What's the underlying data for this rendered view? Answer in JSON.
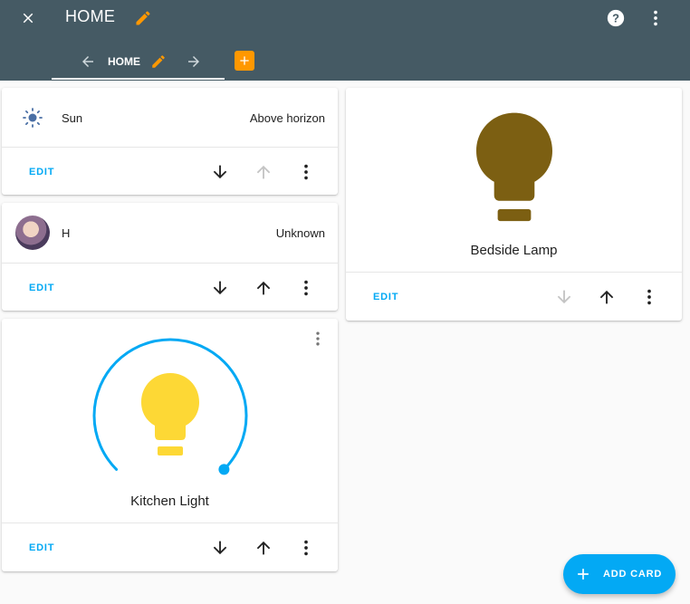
{
  "header": {
    "title": "HOME",
    "tab_label": "HOME"
  },
  "cards": {
    "sun": {
      "name": "Sun",
      "state": "Above horizon",
      "edit_label": "EDIT"
    },
    "person": {
      "name": "H",
      "state": "Unknown",
      "edit_label": "EDIT"
    },
    "kitchen": {
      "name": "Kitchen Light",
      "edit_label": "EDIT"
    },
    "bedside": {
      "name": "Bedside Lamp",
      "edit_label": "EDIT"
    }
  },
  "fab": {
    "label": "ADD CARD"
  },
  "colors": {
    "toolbar": "#455a64",
    "accent": "#03a9f4",
    "orange": "#ff9800",
    "light_on": "#fdd835",
    "lamp_dim": "#7c5f12",
    "sun_icon": "#4a6fa5"
  },
  "icons": [
    "close-icon",
    "pencil-icon",
    "help-icon",
    "dots-vertical-icon",
    "arrow-left-icon",
    "arrow-right-icon",
    "plus-icon",
    "weather-sunny-icon",
    "arrow-down-icon",
    "arrow-up-icon",
    "lightbulb-icon"
  ]
}
